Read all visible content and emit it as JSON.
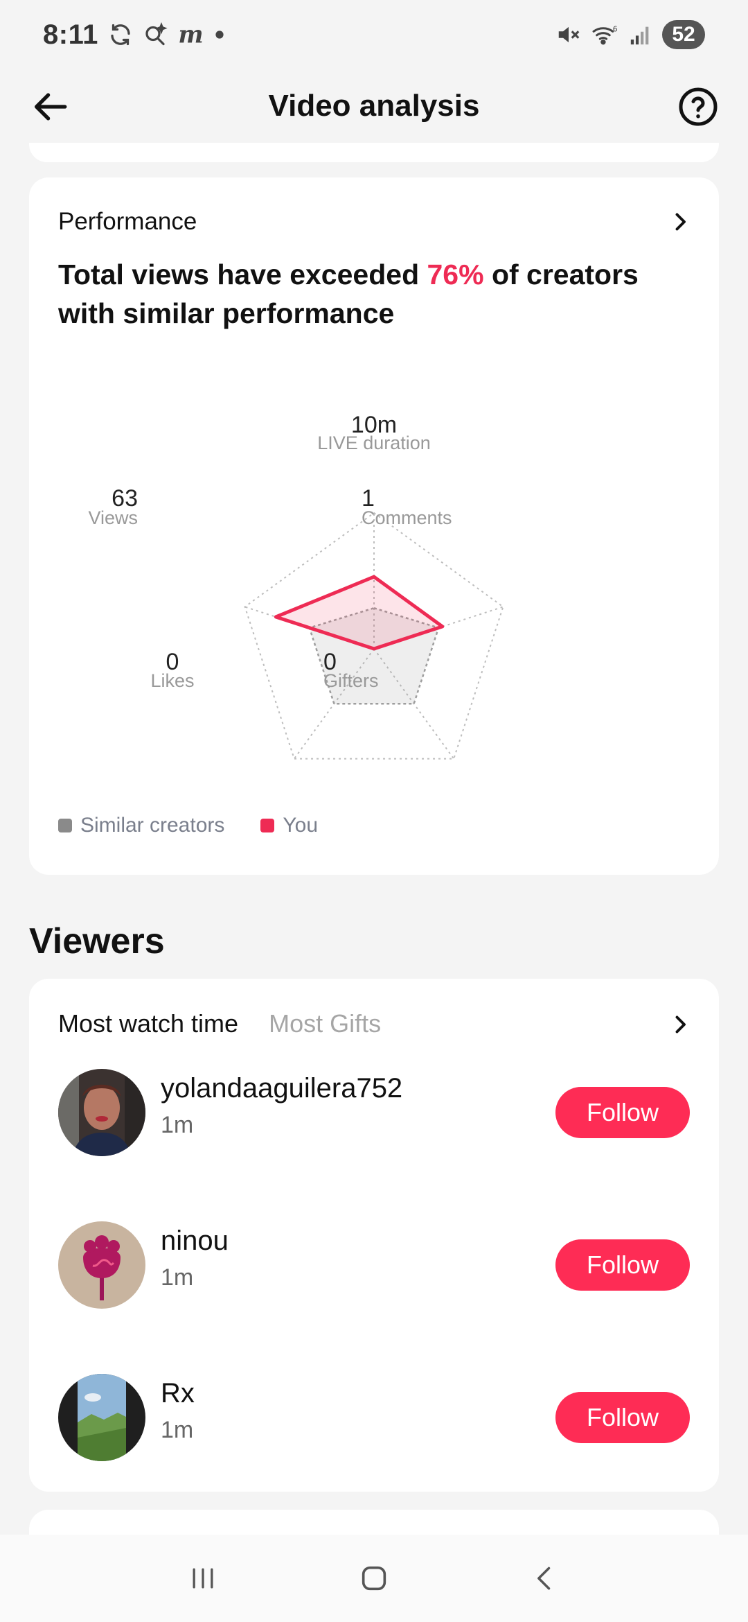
{
  "status_bar": {
    "time": "8:11",
    "battery": "52",
    "icons": [
      "sync-icon",
      "search-sparkle-icon",
      "m-app-icon",
      "dot-icon",
      "mute-icon",
      "wifi-icon",
      "signal-icon",
      "battery-icon"
    ]
  },
  "header": {
    "title": "Video analysis",
    "back_icon": "arrow-left-icon",
    "help_icon": "question-circle-icon"
  },
  "performance": {
    "heading": "Performance",
    "summary_prefix": "Total views have exceeded ",
    "summary_pct": "76%",
    "summary_suffix": " of creators with similar performance",
    "axes": [
      {
        "value": "10m",
        "label": "LIVE duration"
      },
      {
        "value": "1",
        "label": "Comments"
      },
      {
        "value": "0",
        "label": "Gifters"
      },
      {
        "value": "0",
        "label": "Likes"
      },
      {
        "value": "63",
        "label": "Views"
      }
    ],
    "legend": [
      {
        "label": "Similar creators",
        "color": "#8a8a8a"
      },
      {
        "label": "You",
        "color": "#ee2b54"
      }
    ],
    "accent_color": "#ee2b54"
  },
  "chart_data": {
    "type": "radar",
    "axes": [
      "LIVE duration",
      "Comments",
      "Gifters",
      "Likes",
      "Views"
    ],
    "axis_values": [
      "10m",
      "1",
      "0",
      "0",
      "63"
    ],
    "rmax": 1,
    "series": [
      {
        "name": "Similar creators",
        "values": [
          0.3,
          0.5,
          0.5,
          0.5,
          0.5
        ]
      },
      {
        "name": "You",
        "values": [
          0.53,
          0.53,
          0.0,
          0.0,
          0.76
        ]
      }
    ]
  },
  "viewers": {
    "title": "Viewers",
    "tabs": [
      "Most watch time",
      "Most Gifts"
    ],
    "follow_label": "Follow",
    "items": [
      {
        "name": "yolandaaguilera752",
        "time": "1m"
      },
      {
        "name": "ninou",
        "time": "1m"
      },
      {
        "name": "Rx",
        "time": "1m"
      }
    ]
  },
  "nav": {
    "icons": [
      "recent-apps-icon",
      "home-icon",
      "back-icon"
    ]
  }
}
